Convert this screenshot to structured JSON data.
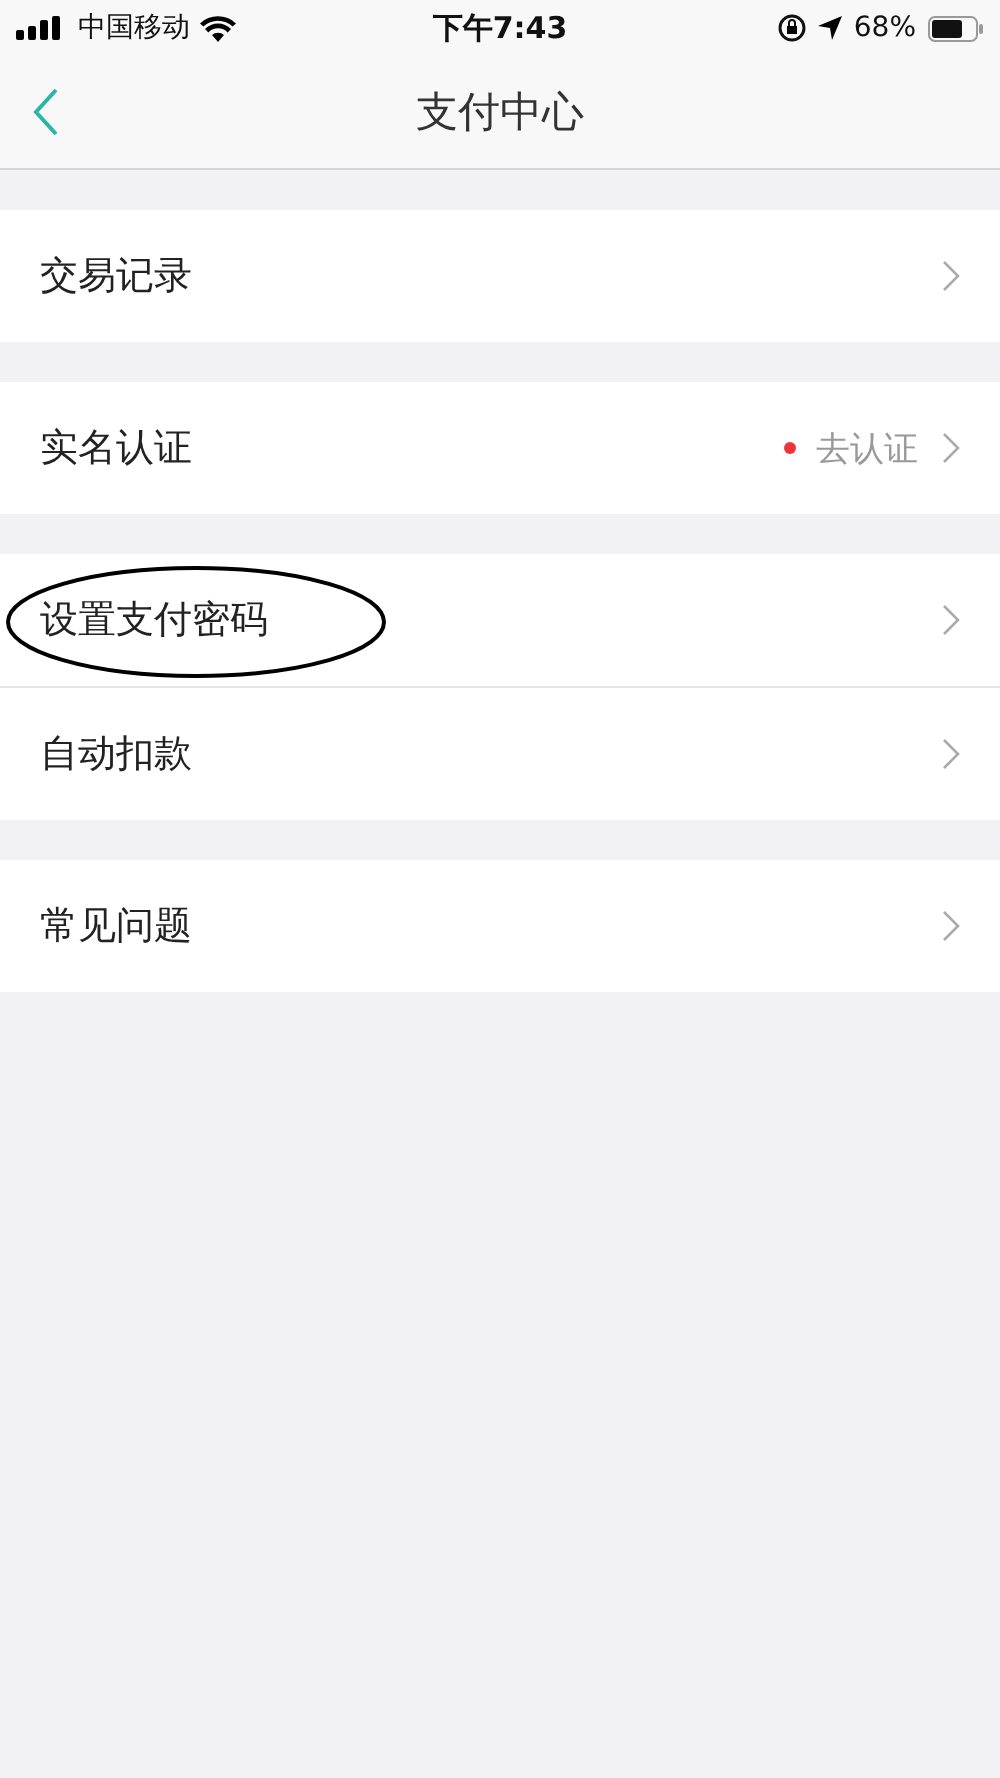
{
  "status_bar": {
    "carrier": "中国移动",
    "time": "下午7:43",
    "battery": "68%"
  },
  "nav": {
    "title": "支付中心"
  },
  "groups": [
    [
      {
        "label": "交易记录",
        "circled": false
      }
    ],
    [
      {
        "label": "实名认证",
        "hint": "去认证",
        "dot": true,
        "circled": false
      }
    ],
    [
      {
        "label": "设置支付密码",
        "circled": true
      },
      {
        "label": "自动扣款",
        "circled": false
      }
    ],
    [
      {
        "label": "常见问题",
        "circled": false
      }
    ]
  ]
}
